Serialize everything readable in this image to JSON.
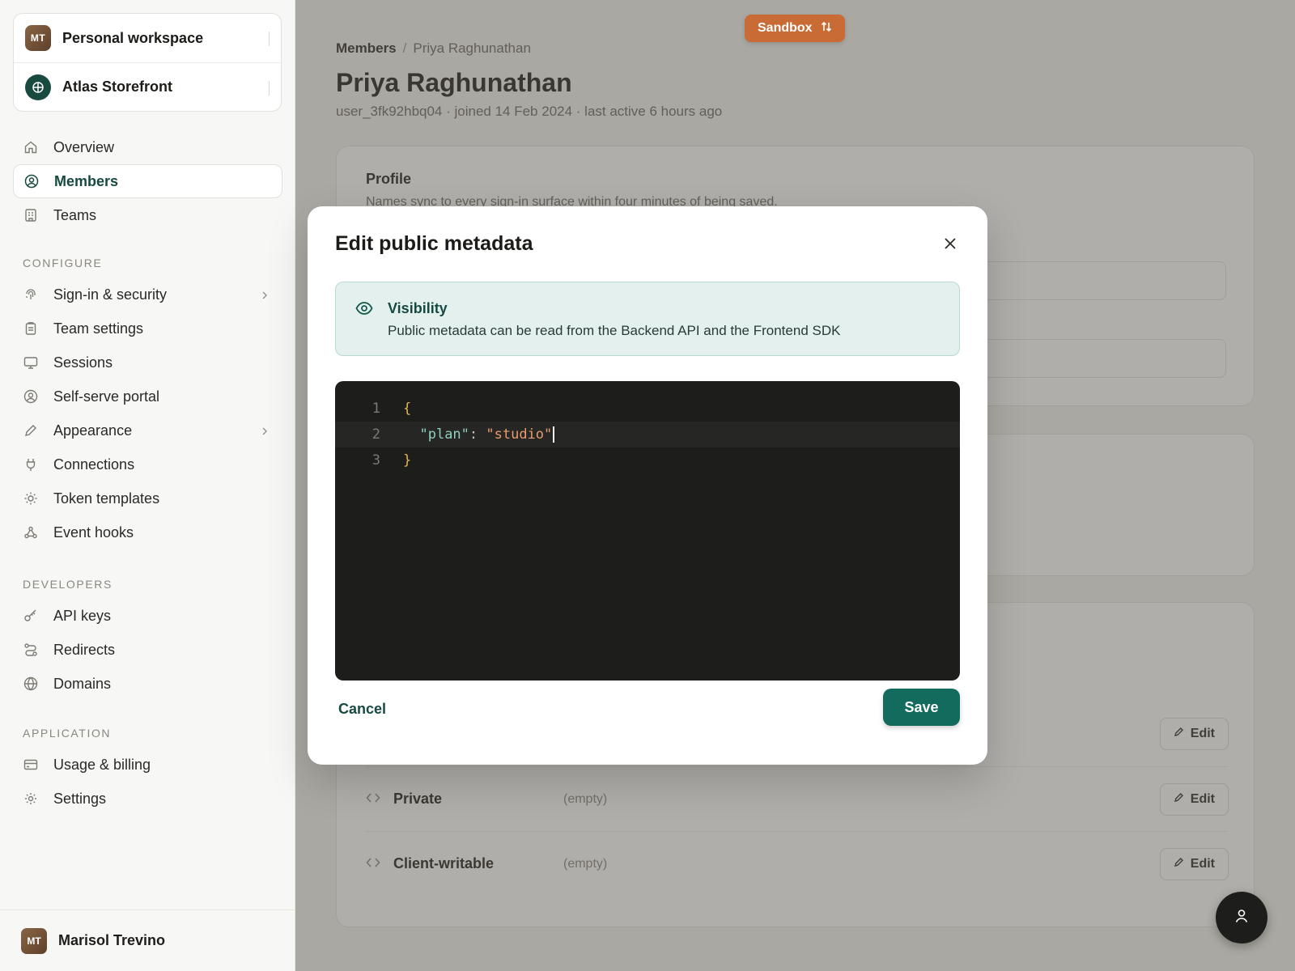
{
  "sidebar": {
    "workspaces": [
      {
        "initials": "MT",
        "name": "Personal workspace"
      },
      {
        "name": "Atlas Storefront"
      }
    ],
    "main_items": [
      {
        "label": "Overview",
        "icon": "home-icon"
      },
      {
        "label": "Members",
        "icon": "user-circle-icon",
        "active": true
      },
      {
        "label": "Teams",
        "icon": "building-icon"
      }
    ],
    "configure_label": "CONFIGURE",
    "configure_items": [
      {
        "label": "Sign-in & security",
        "icon": "fingerprint-icon",
        "chevron": true
      },
      {
        "label": "Team settings",
        "icon": "clipboard-icon"
      },
      {
        "label": "Sessions",
        "icon": "monitor-icon"
      },
      {
        "label": "Self-serve portal",
        "icon": "user-circle-icon"
      },
      {
        "label": "Appearance",
        "icon": "pen-icon",
        "chevron": true
      },
      {
        "label": "Connections",
        "icon": "plug-icon"
      },
      {
        "label": "Token templates",
        "icon": "sun-icon"
      },
      {
        "label": "Event hooks",
        "icon": "webhook-icon"
      }
    ],
    "developers_label": "DEVELOPERS",
    "developer_items": [
      {
        "label": "API keys",
        "icon": "key-icon"
      },
      {
        "label": "Redirects",
        "icon": "route-icon"
      },
      {
        "label": "Domains",
        "icon": "globe-icon"
      }
    ],
    "application_label": "APPLICATION",
    "application_items": [
      {
        "label": "Usage & billing",
        "icon": "credit-card-icon"
      },
      {
        "label": "Settings",
        "icon": "gear-icon"
      }
    ],
    "user": {
      "initials": "MT",
      "name": "Marisol Trevino"
    }
  },
  "header": {
    "env_badge": "Sandbox",
    "breadcrumb_parent": "Members",
    "breadcrumb_sep": "/",
    "breadcrumb_current": "Priya Raghunathan",
    "title": "Priya Raghunathan",
    "subtitle": "user_3fk92hbq04 · joined 14 Feb 2024 · last active 6 hours ago"
  },
  "profile_card": {
    "title": "Profile",
    "subtitle": "Names sync to every sign-in surface within four minutes of being saved."
  },
  "metadata_rows": [
    {
      "name": "Private",
      "value": "(empty)",
      "edit": "Edit"
    },
    {
      "name": "Client-writable",
      "value": "(empty)",
      "edit": "Edit"
    }
  ],
  "metadata_public_edit": "Edit",
  "modal": {
    "title": "Edit public metadata",
    "callout_title": "Visibility",
    "callout_text": "Public metadata can be read from the Backend API and the Frontend SDK",
    "editor_lines": [
      {
        "n": "1",
        "text": "{"
      },
      {
        "n": "2",
        "key": "\"plan\"",
        "colon": ": ",
        "value": "\"studio\""
      },
      {
        "n": "3",
        "text": "}"
      }
    ],
    "cancel_label": "Cancel",
    "save_label": "Save"
  },
  "colors": {
    "accent": "#136b5e",
    "sandbox": "#c96b35",
    "editor_bg": "#1d1d1b"
  }
}
